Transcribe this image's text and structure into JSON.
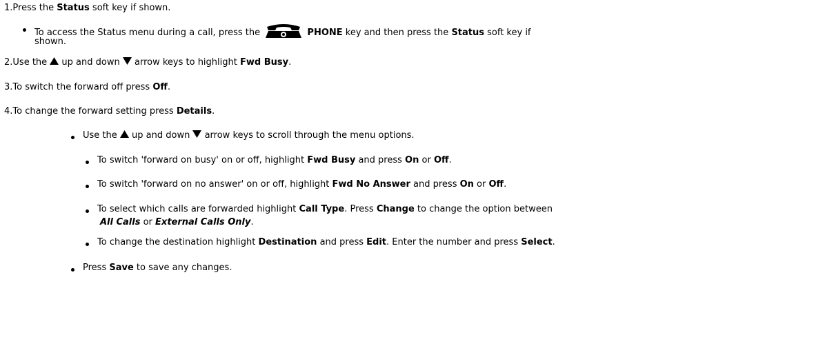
{
  "steps": [
    {
      "number": "1.",
      "pre": "Press the ",
      "b1": "Status",
      "post": " soft key if shown."
    },
    {
      "number": "2.",
      "pre": "Use the ",
      "mid": " up and down ",
      "mid2": " arrow keys to highlight ",
      "b1": "Fwd Busy",
      "post": "."
    },
    {
      "number": "3.",
      "pre": "To switch the forward off press ",
      "b1": "Off",
      "post": "."
    },
    {
      "number": "4.",
      "pre": "To change the forward setting press ",
      "b1": "Details",
      "post": "."
    }
  ],
  "step1_sub": {
    "pre": "To access the Status menu during a call, press the ",
    "b1": "PHONE",
    "mid": " key and then press the ",
    "b2": "Status",
    "post": " soft key if",
    "cont": "shown."
  },
  "step4_sub1": {
    "pre": "Use the ",
    "mid": " up and down ",
    "post": " arrow keys to scroll through the menu options."
  },
  "step4_sub1_items": [
    {
      "pre": "To switch 'forward on busy' on or off, highlight ",
      "b1": "Fwd Busy",
      "mid": " and press ",
      "b2": "On",
      "mid2": " or ",
      "b3": "Off",
      "post": "."
    },
    {
      "pre": "To switch 'forward on no answer' on or off, highlight ",
      "b1": "Fwd No Answer",
      "mid": " and press ",
      "b2": "On",
      "mid2": " or ",
      "b3": "Off",
      "post": "."
    }
  ],
  "calltype_item": {
    "pre": "To select which calls are forwarded highlight ",
    "b1": "Call Type",
    "mid": ". Press ",
    "b2": "Change",
    "post": " to change the option between",
    "bi1": "All Calls",
    "mid2": " or ",
    "bi2": "External Calls Only",
    "post2": "."
  },
  "destination_item": {
    "pre": "To change the destination highlight ",
    "b1": "Destination",
    "mid": " and press ",
    "b2": "Edit",
    "mid2": ". Enter the number and press ",
    "b3": "Select",
    "post": "."
  },
  "save_item": {
    "pre": "Press ",
    "b1": "Save",
    "post": " to save any changes."
  },
  "icons": {
    "phone": "phone-key-icon",
    "up": "up-arrow-icon",
    "down": "down-arrow-icon"
  }
}
